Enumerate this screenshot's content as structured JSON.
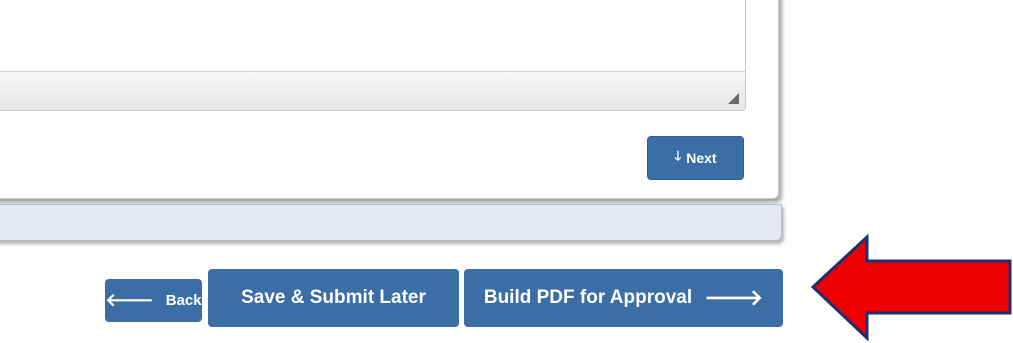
{
  "form": {
    "textarea_value": ""
  },
  "buttons": {
    "next_label": "Next",
    "back_label": "Back",
    "save_label": "Save & Submit Later",
    "build_label": "Build PDF for Approval"
  },
  "icons": {
    "next": "arrow-down-icon",
    "back": "arrow-left-icon",
    "build": "arrow-right-icon",
    "annotation": "red-pointer-arrow"
  },
  "colors": {
    "button_primary": "#3a6ea5",
    "footer_bar": "#e4e9f1",
    "annotation_red": "#ee0000",
    "annotation_outline": "#1f2f6e"
  }
}
